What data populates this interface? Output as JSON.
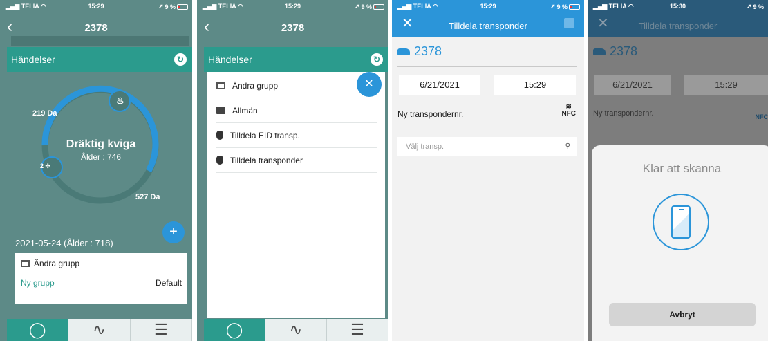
{
  "status_bar": {
    "carrier": "TELIA",
    "battery_text": "9 %",
    "times": [
      "15:29",
      "15:29",
      "15:29",
      "15:30"
    ]
  },
  "screen1": {
    "nav_title": "2378",
    "section_title": "Händelser",
    "ring": {
      "status": "Dräktig kviga",
      "age": "Ålder : 746",
      "label_left": "219 Da",
      "label_right": "527 Da",
      "badge_count": "2"
    },
    "event_date": "2021-05-24 (Ålder : 718)",
    "event_card": {
      "title": "Ändra grupp",
      "field": "Ny grupp",
      "value": "Default"
    }
  },
  "screen2": {
    "nav_title": "2378",
    "section_title": "Händelser",
    "menu": [
      {
        "label": "Ändra grupp",
        "icon": "group-icon"
      },
      {
        "label": "Allmän",
        "icon": "chat-icon"
      },
      {
        "label": "Tilldela EID transp.",
        "icon": "eid-icon"
      },
      {
        "label": "Tilldela transponder",
        "icon": "eid-icon"
      }
    ]
  },
  "screen3": {
    "nav_title": "Tilldela transponder",
    "animal_id": "2378",
    "date": "6/21/2021",
    "time": "15:29",
    "field_label": "Ny transpondernr.",
    "nfc_label": "NFC",
    "select_placeholder": "Välj transp."
  },
  "screen4": {
    "nav_title": "Tilldela transponder",
    "animal_id": "2378",
    "date": "6/21/2021",
    "time": "15:29",
    "field_label": "Ny transpondernr.",
    "nfc_label": "NFC",
    "sheet_title": "Klar att skanna",
    "cancel_label": "Avbryt"
  },
  "colors": {
    "teal": "#2b9b8d",
    "blue": "#2b95d9",
    "background_teal": "#5d8a87"
  }
}
